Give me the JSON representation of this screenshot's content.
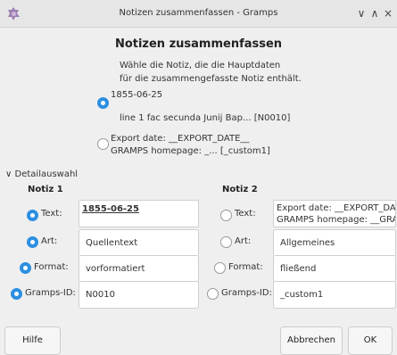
{
  "window": {
    "title": "Notizen zusammenfassen - Gramps",
    "app_icon": "gramps-icon",
    "controls": [
      "chevron-down-icon",
      "chevron-up-icon",
      "close-icon"
    ],
    "minimize_glyph": "∨",
    "maximize_glyph": "∧",
    "close_glyph": "×"
  },
  "dialog": {
    "heading": "Notizen zusammenfassen",
    "intro_line1": "Wähle die Notiz, die die Hauptdaten",
    "intro_line2": "für die zusammengefasste Notiz enthält.",
    "choice1_line1": "1855-06-25",
    "choice1_line2": "line 1   fac secunda Junij Bap... [N0010]",
    "choice2_line1": "Export date: __EXPORT_DATE__",
    "choice2_line2": "GRAMPS homepage: _... [_custom1]",
    "selected_choice": 1
  },
  "details": {
    "expander_glyph": "∨",
    "expander_label": "Detailauswahl",
    "note1_heading": "Notiz 1",
    "note2_heading": "Notiz 2",
    "labels": {
      "text": "Text:",
      "type": "Art:",
      "format": "Format:",
      "id": "Gramps-ID:"
    },
    "note1": {
      "text": "1855-06-25",
      "type": "Quellentext",
      "format": "vorformatiert",
      "id": "N0010"
    },
    "note2": {
      "text_line1": "Export date: __EXPORT_DATE_",
      "text_line2": "GRAMPS homepage: __GRAM",
      "type": "Allgemeines",
      "format": "fließend",
      "id": "_custom1"
    }
  },
  "buttons": {
    "help": "Hilfe",
    "cancel": "Abbrechen",
    "ok": "OK"
  },
  "colors": {
    "accent": "#2d8fe0",
    "background": "#efefef"
  }
}
